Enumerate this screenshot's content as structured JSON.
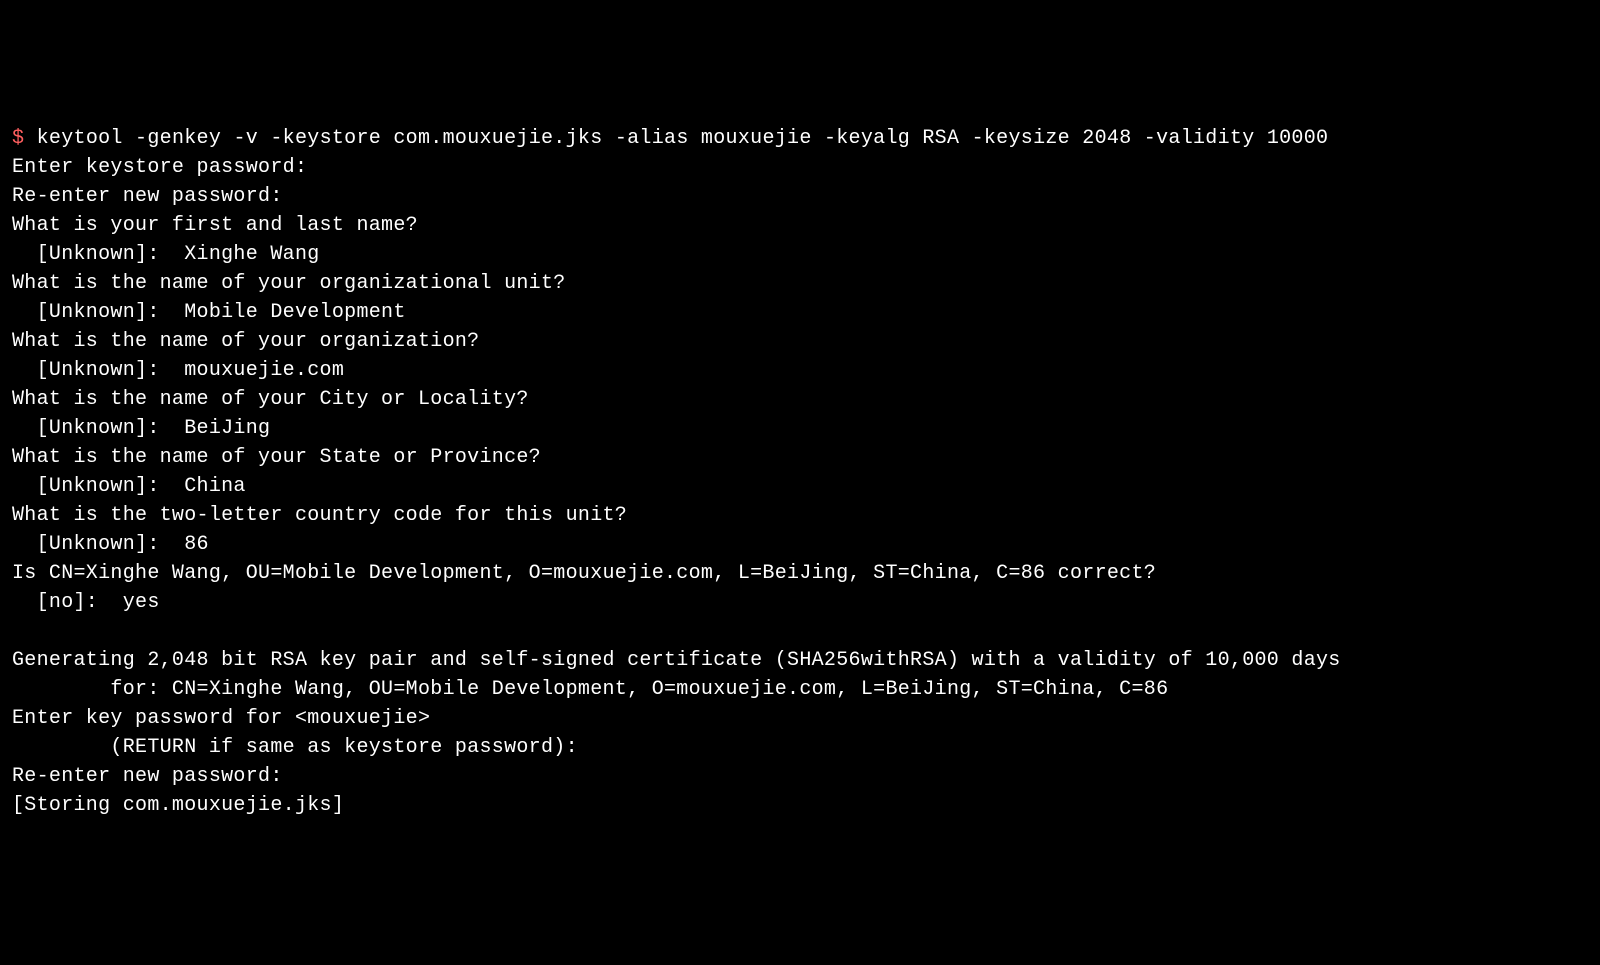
{
  "terminal": {
    "prompt": "$",
    "command": "keytool -genkey -v -keystore com.mouxuejie.jks -alias mouxuejie -keyalg RSA -keysize 2048 -validity 10000",
    "lines": [
      "Enter keystore password:",
      "Re-enter new password:",
      "What is your first and last name?",
      "  [Unknown]:  Xinghe Wang",
      "What is the name of your organizational unit?",
      "  [Unknown]:  Mobile Development",
      "What is the name of your organization?",
      "  [Unknown]:  mouxuejie.com",
      "What is the name of your City or Locality?",
      "  [Unknown]:  BeiJing",
      "What is the name of your State or Province?",
      "  [Unknown]:  China",
      "What is the two-letter country code for this unit?",
      "  [Unknown]:  86",
      "Is CN=Xinghe Wang, OU=Mobile Development, O=mouxuejie.com, L=BeiJing, ST=China, C=86 correct?",
      "  [no]:  yes",
      "",
      "Generating 2,048 bit RSA key pair and self-signed certificate (SHA256withRSA) with a validity of 10,000 days",
      "        for: CN=Xinghe Wang, OU=Mobile Development, O=mouxuejie.com, L=BeiJing, ST=China, C=86",
      "Enter key password for <mouxuejie>",
      "        (RETURN if same as keystore password):",
      "Re-enter new password:",
      "[Storing com.mouxuejie.jks]"
    ]
  }
}
